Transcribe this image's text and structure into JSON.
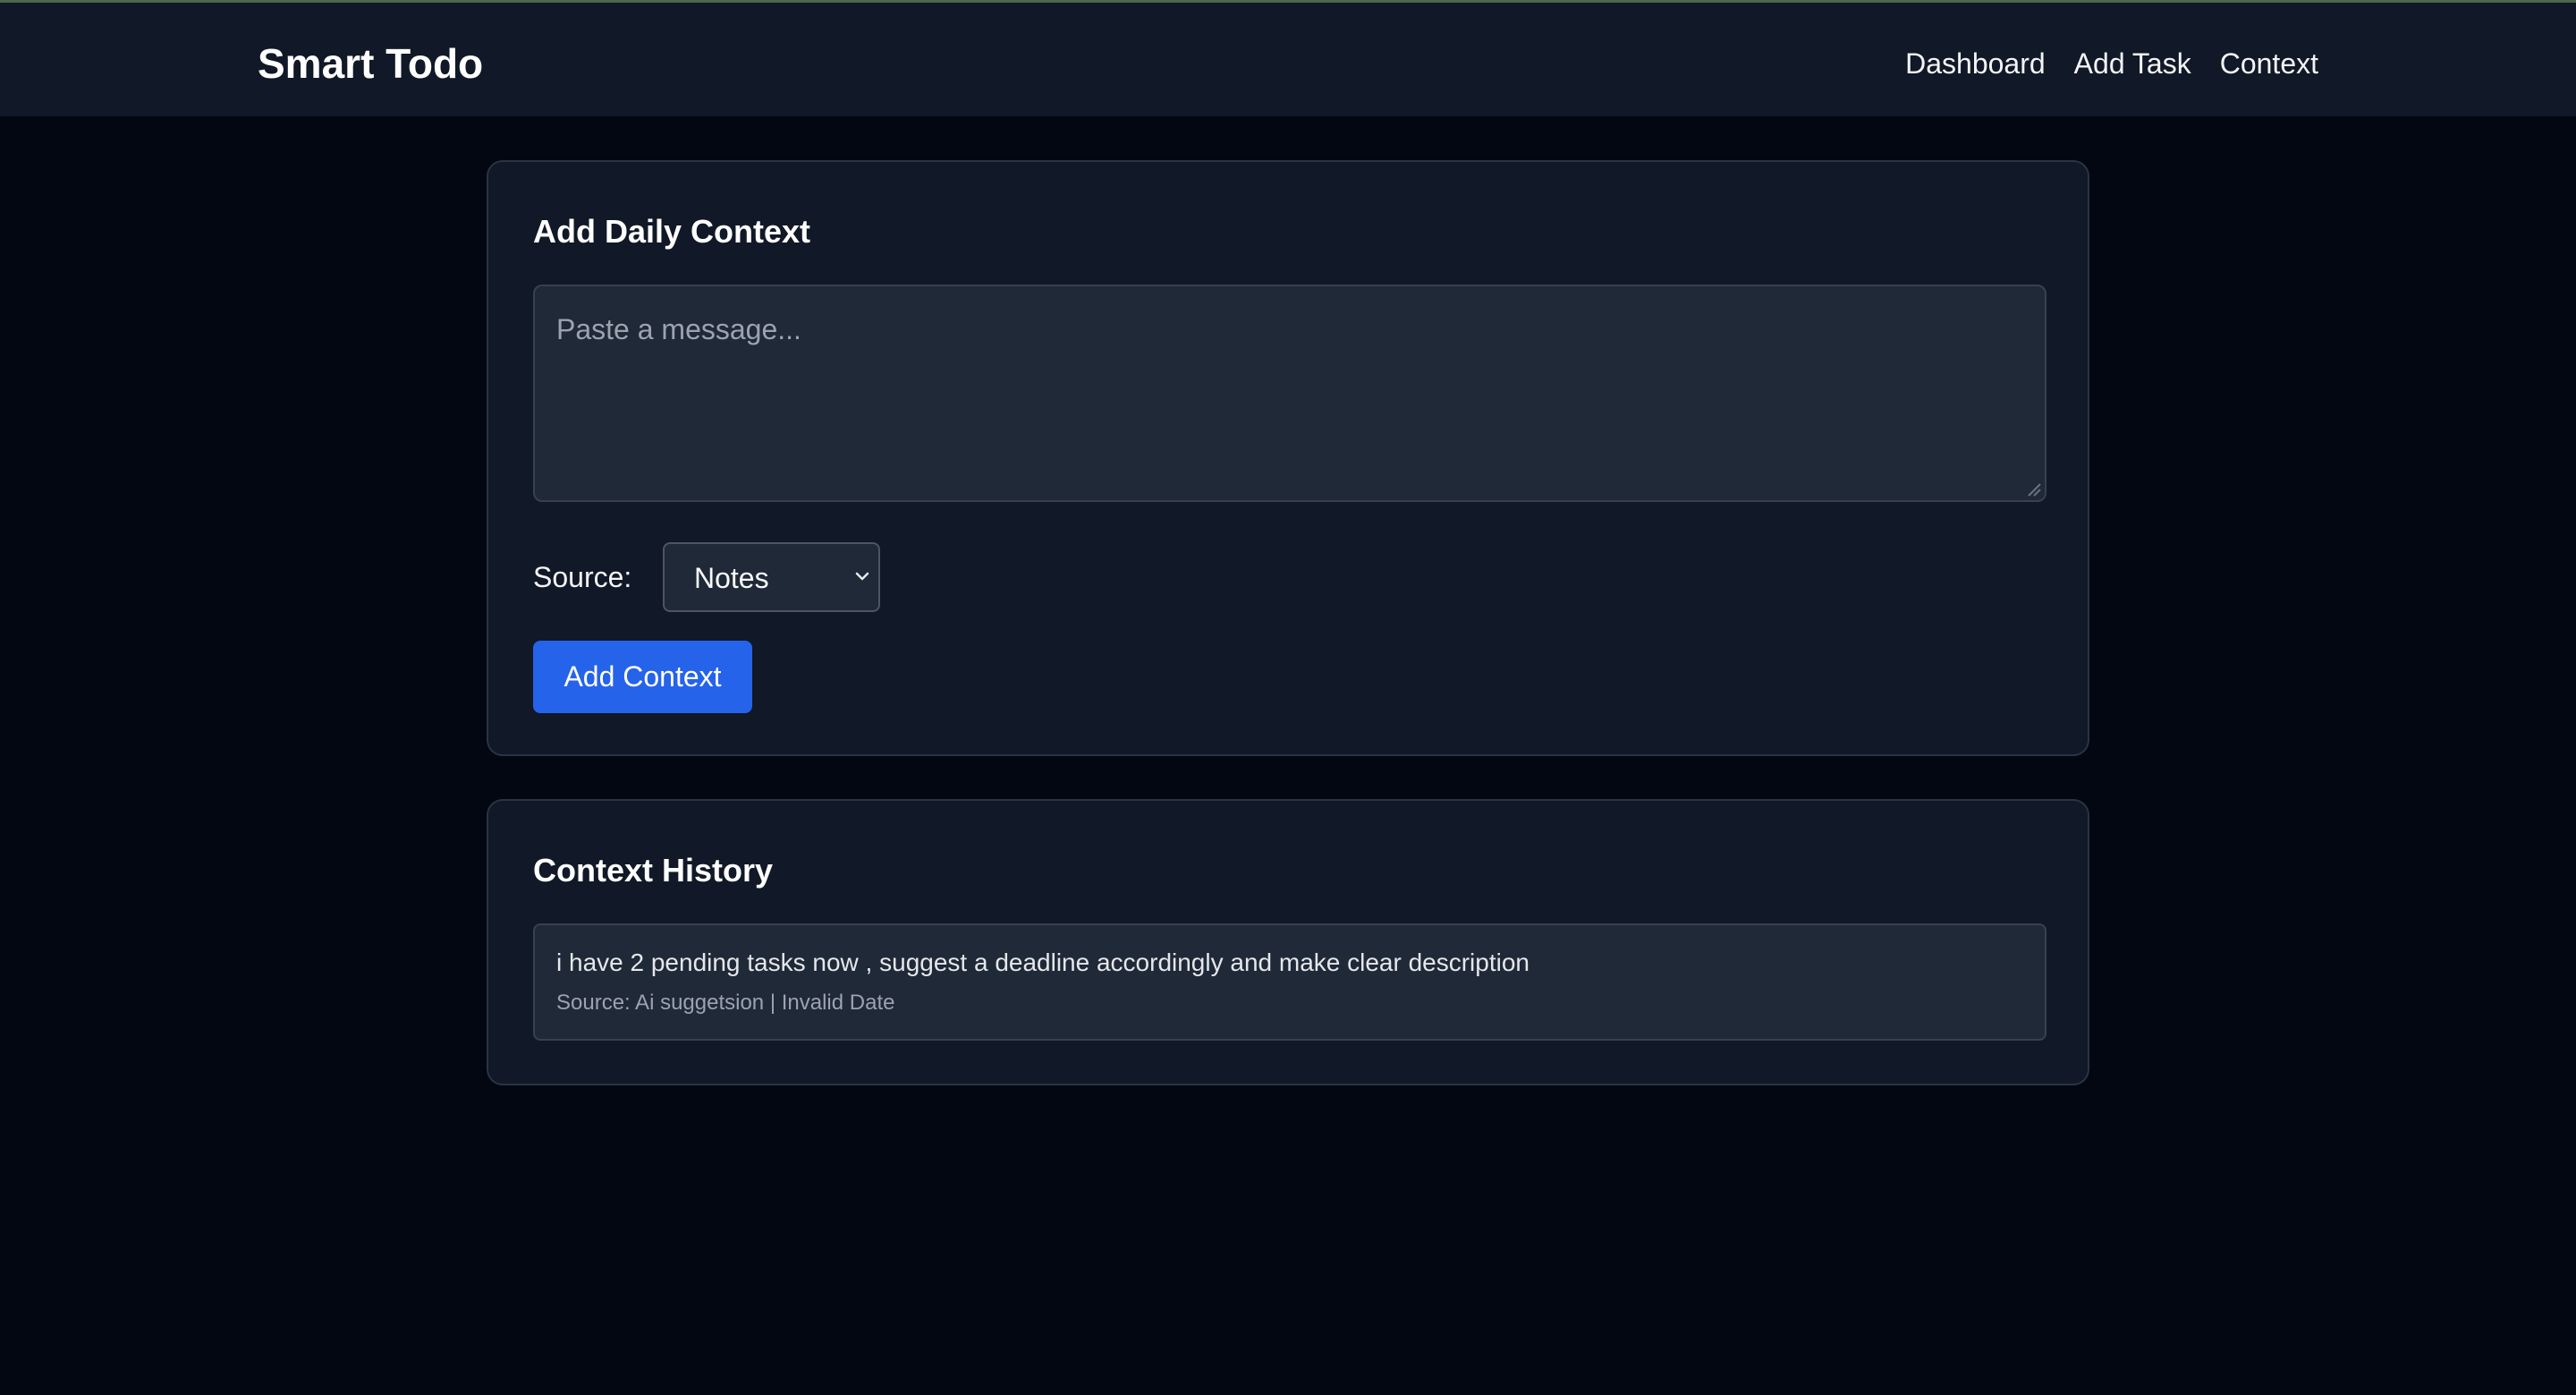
{
  "app": {
    "brand": "Smart Todo",
    "accent_color": "#2563eb",
    "background_color": "#030712"
  },
  "nav": {
    "items": [
      {
        "label": "Dashboard"
      },
      {
        "label": "Add Task"
      },
      {
        "label": "Context"
      }
    ]
  },
  "add_context": {
    "title": "Add Daily Context",
    "message_placeholder": "Paste a message...",
    "message_value": "",
    "source_label": "Source:",
    "source_selected": "Notes",
    "submit_label": "Add Context"
  },
  "history": {
    "title": "Context History",
    "items": [
      {
        "text": "i have 2 pending tasks now , suggest a deadline accordingly and make clear description",
        "meta": "Source: Ai suggetsion | Invalid Date"
      }
    ]
  }
}
